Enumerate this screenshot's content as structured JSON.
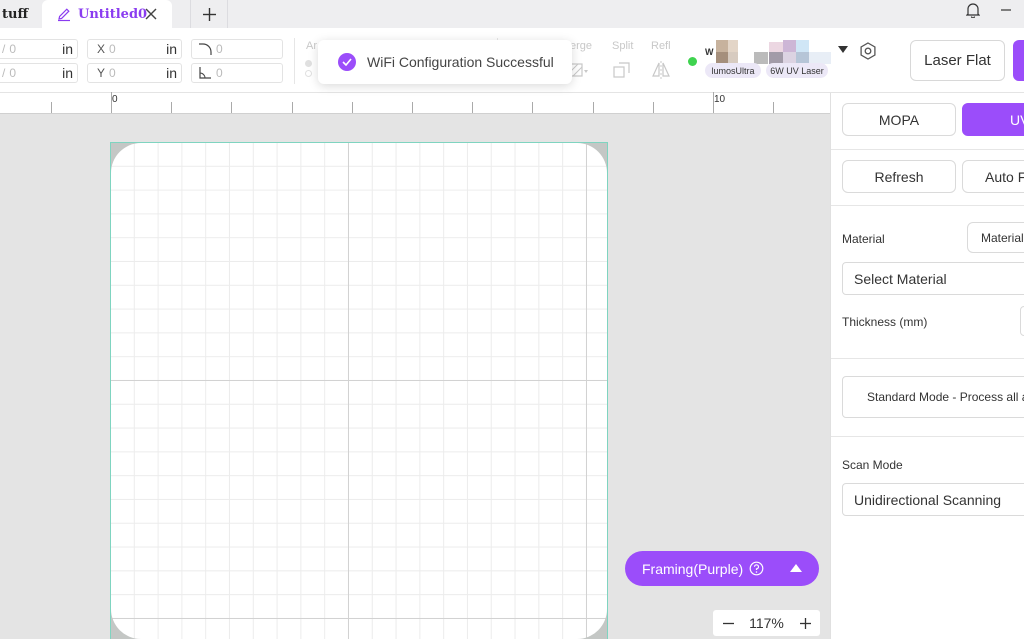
{
  "tabs": {
    "prev_label": "tuff",
    "active_label": "Untitled0"
  },
  "toolbar": {
    "width_value": "0",
    "height_value": "0",
    "x_label": "X",
    "x_value": "0",
    "y_label": "Y",
    "y_value": "0",
    "unit": "in",
    "corner_value": "0",
    "angle_value": "0",
    "faded_labels": [
      "Ar",
      "erge",
      "Split",
      "Refl"
    ]
  },
  "toast": {
    "message": "WiFi Configuration Successful"
  },
  "device": {
    "name_prefix": "W",
    "model": "lumosUltra",
    "laser": "6W UV Laser",
    "status_color": "#3fd34f"
  },
  "header_buttons": {
    "laser_flat": "Laser Flat"
  },
  "ruler": {
    "labels": [
      "0",
      "10"
    ]
  },
  "canvas": {
    "framing_label": "Framing(Purple)",
    "zoom_value": "117%"
  },
  "panel": {
    "mode_mopa": "MOPA",
    "mode_uv": "UV",
    "refresh": "Refresh",
    "auto": "Auto F",
    "material_label": "Material",
    "material_button": "Material",
    "select_material": "Select Material",
    "thickness_label": "Thickness (mm)",
    "process_mode": "Standard Mode - Process all a",
    "scan_mode_label": "Scan Mode",
    "scan_mode_value": "Unidirectional Scanning"
  },
  "colors": {
    "accent": "#9b4dfa",
    "board_border": "#7fd4c0"
  }
}
